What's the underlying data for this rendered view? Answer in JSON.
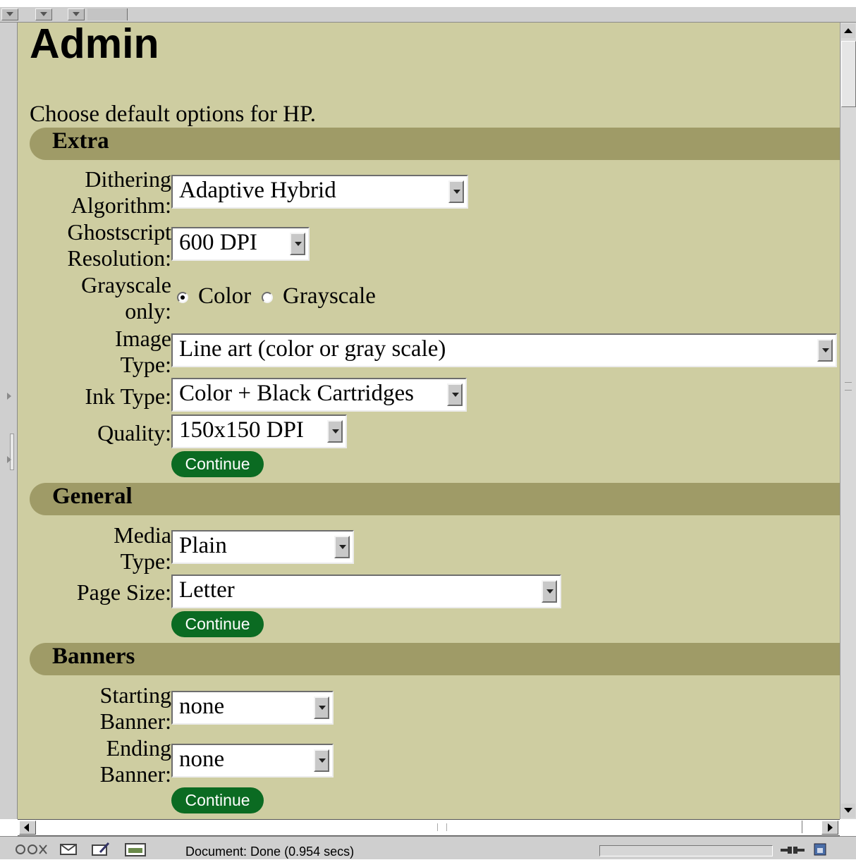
{
  "page": {
    "title": "Admin",
    "intro": "Choose default options for HP."
  },
  "sections": {
    "extra": {
      "title": "Extra",
      "dithering": {
        "label_line1": "Dithering",
        "label_line2": "Algorithm:",
        "value": "Adaptive Hybrid"
      },
      "resolution": {
        "label_line1": "Ghostscript",
        "label_line2": "Resolution:",
        "value": "600 DPI"
      },
      "grayscale": {
        "label_line1": "Grayscale",
        "label_line2": "only:",
        "options": [
          "Color",
          "Grayscale"
        ],
        "selected": "Color"
      },
      "image_type": {
        "label_line1": "Image",
        "label_line2": "Type:",
        "value": "Line art (color or gray scale)"
      },
      "ink_type": {
        "label": "Ink Type:",
        "value": "Color + Black Cartridges"
      },
      "quality": {
        "label": "Quality:",
        "value": "150x150 DPI"
      },
      "continue_label": "Continue"
    },
    "general": {
      "title": "General",
      "media_type": {
        "label_line1": "Media",
        "label_line2": "Type:",
        "value": "Plain"
      },
      "page_size": {
        "label": "Page Size:",
        "value": "Letter"
      },
      "continue_label": "Continue"
    },
    "banners": {
      "title": "Banners",
      "starting": {
        "label_line1": "Starting",
        "label_line2": "Banner:",
        "value": "none"
      },
      "ending": {
        "label_line1": "Ending",
        "label_line2": "Banner:",
        "value": "none"
      },
      "continue_label": "Continue"
    }
  },
  "status_bar": {
    "text": "Document: Done (0.954 secs)",
    "icons": [
      "navigator-icon",
      "mail-icon",
      "composer-icon",
      "address-book-icon",
      "connection-icon",
      "security-lock-icon"
    ]
  },
  "colors": {
    "page_background": "#cecda1",
    "section_bar": "#9f9b67",
    "continue_button": "#0b6b22",
    "chrome": "#cfcfcf"
  }
}
